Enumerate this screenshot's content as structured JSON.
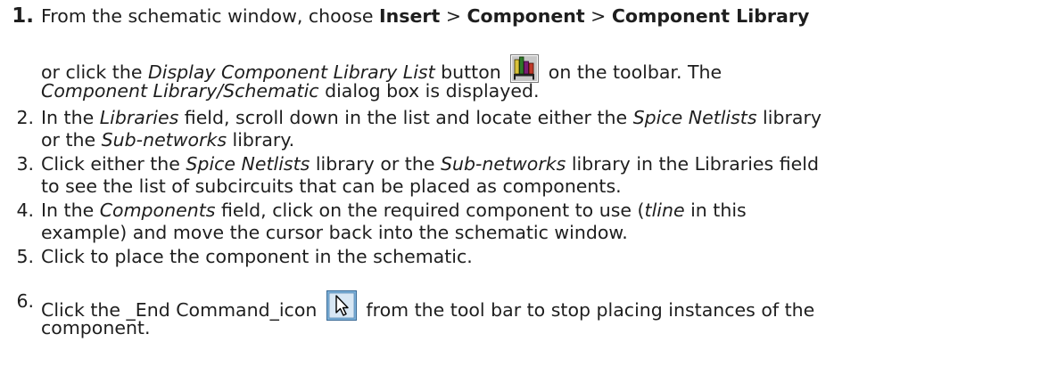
{
  "steps": [
    {
      "number": "1.",
      "parts": [
        "From the schematic window, choose ",
        "Insert",
        " > ",
        "Component",
        " > ",
        "Component Library",
        "or click the ",
        "Display Component Library List",
        " button ",
        " on the toolbar. The",
        "Component Library/Schematic",
        " dialog box is displayed."
      ],
      "icon": "component-library-list-icon"
    },
    {
      "number": "2.",
      "parts": [
        "In the ",
        "Libraries",
        " field, scroll down in the list and locate either the ",
        "Spice Netlists",
        " library",
        "or the ",
        "Sub-networks",
        " library."
      ]
    },
    {
      "number": "3.",
      "parts": [
        "Click either the ",
        "Spice Netlists",
        " library or the ",
        "Sub-networks",
        " library in the Libraries field",
        "to see the list of subcircuits that can be placed as components."
      ]
    },
    {
      "number": "4.",
      "parts": [
        "In the ",
        "Components",
        " field, click on the required component to use (",
        "tline",
        " in this",
        "example) and move the cursor back into the schematic window."
      ]
    },
    {
      "number": "5.",
      "parts": [
        "Click to place the component in the schematic."
      ]
    },
    {
      "number": "6.",
      "parts": [
        "Click the _End Command_icon ",
        " from the tool bar to stop placing instances of the",
        "component."
      ],
      "icon": "end-command-arrow-icon"
    }
  ]
}
